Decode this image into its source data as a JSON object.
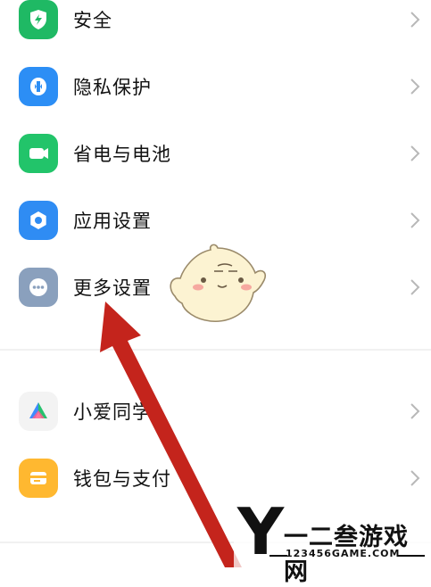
{
  "settings_items": [
    {
      "label": "安全",
      "icon": "shield-icon",
      "color": "#1fb964"
    },
    {
      "label": "隐私保护",
      "icon": "privacy-icon",
      "color": "#2c8ef5"
    },
    {
      "label": "省电与电池",
      "icon": "battery-icon",
      "color": "#22c46a"
    },
    {
      "label": "应用设置",
      "icon": "gear-icon",
      "color": "#2f8cf3"
    },
    {
      "label": "更多设置",
      "icon": "more-dots-icon",
      "color": "#8aa0bd"
    }
  ],
  "secondary_items": [
    {
      "label": "小爱同学",
      "icon": "xiaoai-icon",
      "color": "#f0f0f0"
    },
    {
      "label": "钱包与支付",
      "icon": "wallet-icon",
      "color": "#ffb830"
    }
  ],
  "annotation": {
    "arrow_color": "#c4241c"
  },
  "watermark": {
    "logo": "Y",
    "name": "一二叁游戏网",
    "url": "123456GAME.COM"
  }
}
